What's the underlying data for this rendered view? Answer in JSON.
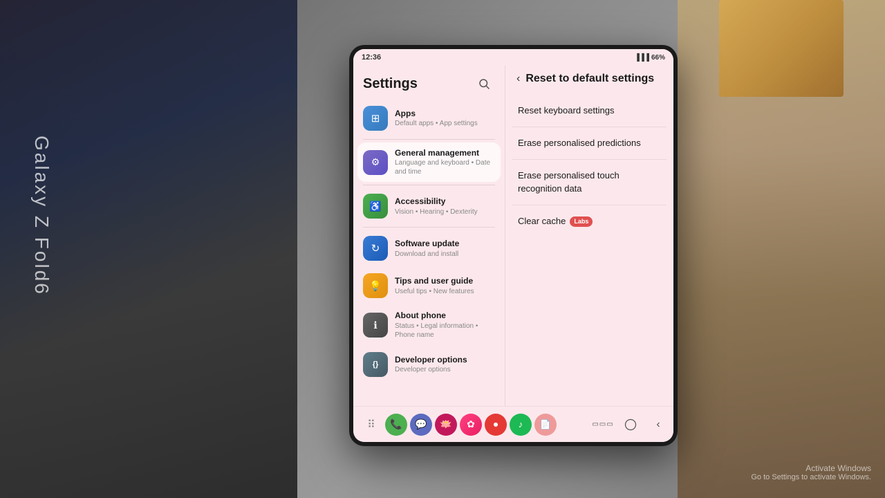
{
  "background": {
    "color": "#7a7a7a"
  },
  "brand_text": "Galaxy Z Fold6",
  "phone": {
    "status_bar": {
      "time": "12:36",
      "battery": "66%",
      "icons": "signals"
    },
    "settings_panel": {
      "title": "Settings",
      "search_icon": "🔍",
      "items": [
        {
          "id": "apps",
          "name": "Apps",
          "subtitle": "Default apps • App settings",
          "icon_color": "#4a90d9",
          "icon_symbol": "⊞",
          "active": false
        },
        {
          "id": "general-management",
          "name": "General management",
          "subtitle": "Language and keyboard • Date and time",
          "icon_color": "#6c7bc4",
          "icon_symbol": "⚙",
          "active": true
        },
        {
          "id": "accessibility",
          "name": "Accessibility",
          "subtitle": "Vision • Hearing • Dexterity",
          "icon_color": "#4caf50",
          "icon_symbol": "♿",
          "active": false
        },
        {
          "id": "software-update",
          "name": "Software update",
          "subtitle": "Download and install",
          "icon_color": "#3a7bd5",
          "icon_symbol": "↻",
          "active": false
        },
        {
          "id": "tips",
          "name": "Tips and user guide",
          "subtitle": "Useful tips • New features",
          "icon_color": "#f5a623",
          "icon_symbol": "💡",
          "active": false
        },
        {
          "id": "about-phone",
          "name": "About phone",
          "subtitle": "Status • Legal information • Phone name",
          "icon_color": "#555",
          "icon_symbol": "ℹ",
          "active": false
        },
        {
          "id": "developer-options",
          "name": "Developer options",
          "subtitle": "Developer options",
          "icon_color": "#555",
          "icon_symbol": "{ }",
          "active": false
        }
      ]
    },
    "reset_panel": {
      "title": "Reset to default settings",
      "back_label": "‹",
      "items": [
        {
          "id": "reset-keyboard",
          "text": "Reset keyboard settings",
          "has_badge": false,
          "badge_text": ""
        },
        {
          "id": "erase-predictions",
          "text": "Erase personalised predictions",
          "has_badge": false,
          "badge_text": ""
        },
        {
          "id": "erase-touch",
          "text": "Erase personalised touch recognition data",
          "has_badge": false,
          "badge_text": ""
        },
        {
          "id": "clear-cache",
          "text": "Clear cache",
          "has_badge": true,
          "badge_text": "Labs"
        }
      ]
    },
    "nav_bar": {
      "dock_icons": [
        {
          "id": "grid",
          "symbol": "⠿",
          "color": "#888"
        },
        {
          "id": "phone",
          "symbol": "📞",
          "color": "#4caf50",
          "bg": "#4caf50"
        },
        {
          "id": "messages",
          "symbol": "💬",
          "color": "#5c6bc0",
          "bg": "#5c6bc0"
        },
        {
          "id": "lotus",
          "symbol": "🪷",
          "color": "#d85b8a",
          "bg": "#d85b8a"
        },
        {
          "id": "flower",
          "symbol": "✿",
          "color": "#e91e63",
          "bg": "#f48fb1"
        },
        {
          "id": "record",
          "symbol": "⏺",
          "color": "#e53935",
          "bg": "#e53935"
        },
        {
          "id": "spotify",
          "symbol": "♪",
          "color": "#1db954",
          "bg": "#1db954"
        },
        {
          "id": "pdf",
          "symbol": "📄",
          "color": "#f44336",
          "bg": "#ef9a9a"
        }
      ],
      "nav_buttons": [
        {
          "id": "recent",
          "symbol": "▭▭▭",
          "label": "Recent apps"
        },
        {
          "id": "home",
          "symbol": "○",
          "label": "Home"
        },
        {
          "id": "back",
          "symbol": "‹",
          "label": "Back"
        }
      ]
    }
  },
  "windows_watermark": {
    "line1": "Activate Windows",
    "line2": "Go to Settings to activate Windows."
  }
}
